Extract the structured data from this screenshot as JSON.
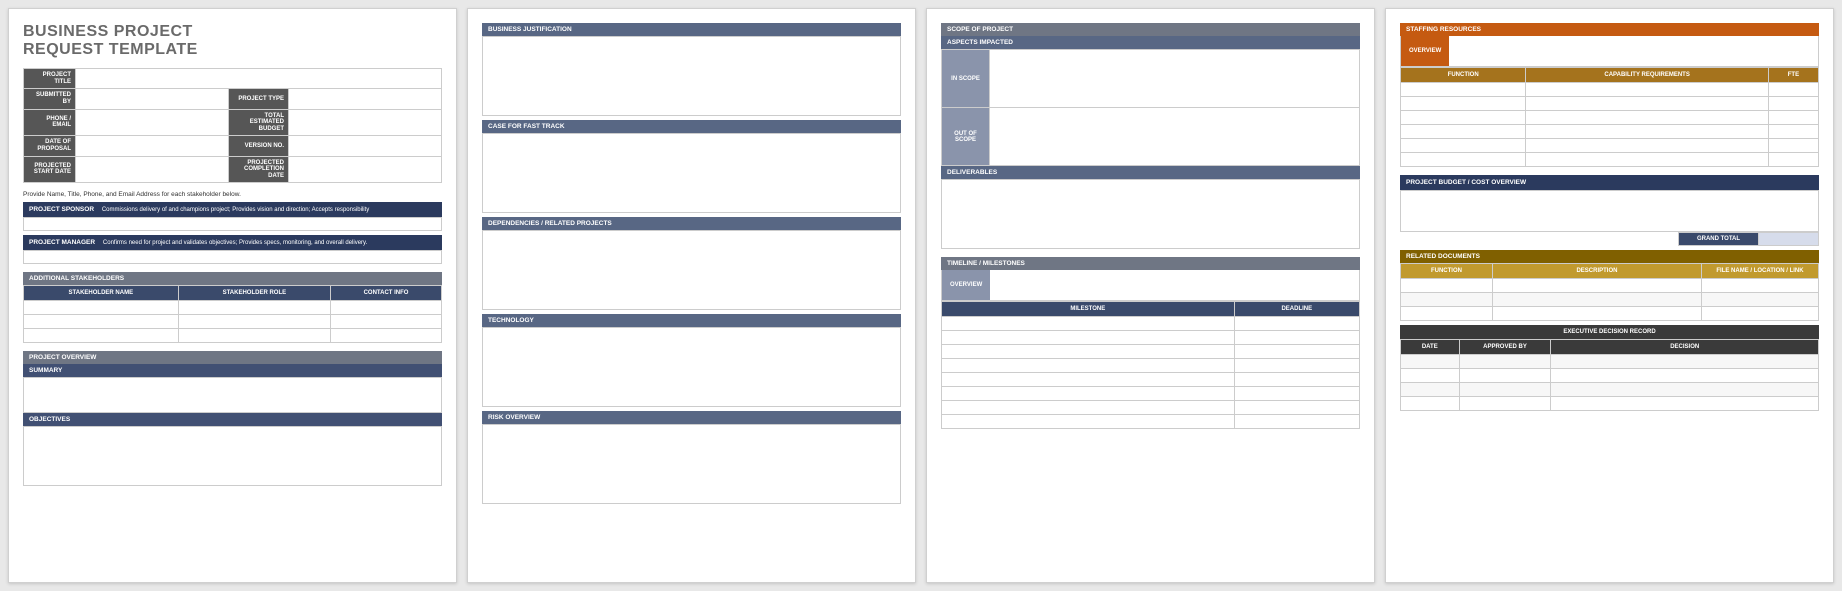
{
  "title_line1": "BUSINESS PROJECT",
  "title_line2": "REQUEST TEMPLATE",
  "info": {
    "project_title": "PROJECT TITLE",
    "submitted_by": "SUBMITTED BY",
    "project_type": "PROJECT TYPE",
    "phone_email": "PHONE / EMAIL",
    "total_budget": "TOTAL ESTIMATED BUDGET",
    "date_proposal": "DATE OF PROPOSAL",
    "version_no": "VERSION NO.",
    "proj_start": "PROJECTED START DATE",
    "proj_completion": "PROJECTED COMPLETION DATE"
  },
  "stakeholder_note": "Provide Name, Title, Phone, and Email Address for each stakeholder below.",
  "sponsor": {
    "label": "PROJECT SPONSOR",
    "desc": "Commissions delivery of and champions project; Provides vision and direction; Accepts responsibility"
  },
  "manager": {
    "label": "PROJECT MANAGER",
    "desc": "Confirms need for project and validates objectives; Provides specs, monitoring, and overall delivery."
  },
  "addl_stakeholders": {
    "label": "ADDITIONAL STAKEHOLDERS",
    "cols": [
      "STAKEHOLDER NAME",
      "STAKEHOLDER ROLE",
      "CONTACT INFO"
    ]
  },
  "overview": {
    "label": "PROJECT OVERVIEW",
    "summary": "SUMMARY",
    "objectives": "OBJECTIVES"
  },
  "p2": {
    "biz_just": "BUSINESS JUSTIFICATION",
    "fast_track": "CASE FOR FAST TRACK",
    "deps": "DEPENDENCIES / RELATED PROJECTS",
    "tech": "TECHNOLOGY",
    "risk": "RISK OVERVIEW"
  },
  "p3": {
    "scope": "SCOPE OF PROJECT",
    "aspects": "ASPECTS IMPACTED",
    "in_scope": "IN SCOPE",
    "out_scope": "OUT OF SCOPE",
    "deliverables": "DELIVERABLES",
    "timeline": "TIMELINE / MILESTONES",
    "overview_tab": "OVERVIEW",
    "milestone": "MILESTONE",
    "deadline": "DEADLINE"
  },
  "p4": {
    "staffing": "STAFFING RESOURCES",
    "overview_tab": "OVERVIEW",
    "function": "FUNCTION",
    "capability": "CAPABILITY REQUIREMENTS",
    "fte": "FTE",
    "budget": "PROJECT BUDGET / COST OVERVIEW",
    "grand_total": "GRAND TOTAL",
    "related_docs": "RELATED DOCUMENTS",
    "rd_function": "FUNCTION",
    "rd_desc": "DESCRIPTION",
    "rd_file": "FILE NAME / LOCATION / LINK",
    "edr": "EXECUTIVE DECISION RECORD",
    "date": "DATE",
    "approved_by": "APPROVED BY",
    "decision": "DECISION"
  }
}
